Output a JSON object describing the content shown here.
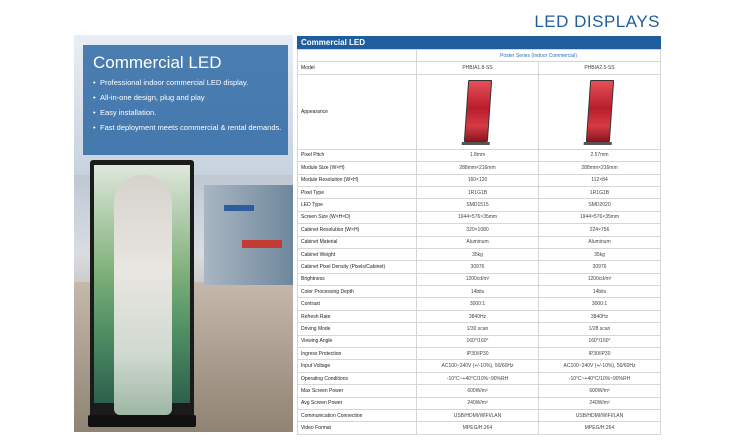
{
  "page_title": "LED DISPLAYS",
  "hero": {
    "title": "Commercial LED",
    "bullets": [
      "Professional indoor commercial LED display.",
      "All-in-one design, plug and play",
      "Easy installation.",
      "Fast deployment meets commercial & rental demands."
    ]
  },
  "table": {
    "header": "Commercial LED",
    "series": "Poster Series (Indoor Commercial)",
    "models": [
      "PHBIA1.8-SS",
      "PHBIA2.5-SS"
    ],
    "rows": [
      {
        "label": "Model",
        "values": [
          "PHBIA1.8-SS",
          "PHBIA2.5-SS"
        ]
      },
      {
        "label": "Appearance",
        "values": [
          "",
          ""
        ]
      },
      {
        "label": "Pixel Pitch",
        "values": [
          "1.8mm",
          "2.57mm"
        ]
      },
      {
        "label": "Module Size (W×H)",
        "values": [
          "288mm×216mm",
          "288mm×216mm"
        ]
      },
      {
        "label": "Module Resolution (W×H)",
        "values": [
          "160×120",
          "112×84"
        ]
      },
      {
        "label": "Pixel Type",
        "values": [
          "1R1G1B",
          "1R1G1B"
        ]
      },
      {
        "label": "LED Type",
        "values": [
          "SMD1515",
          "SMD2020"
        ]
      },
      {
        "label": "Screen Size (W×H×D)",
        "values": [
          "1944×576×35mm",
          "1944×576×35mm"
        ]
      },
      {
        "label": "Cabinet Resolution (W×H)",
        "values": [
          "320×1080",
          "224×756"
        ]
      },
      {
        "label": "Cabinet Material",
        "values": [
          "Aluminum",
          "Aluminum"
        ]
      },
      {
        "label": "Cabinet Weight",
        "values": [
          "35kg",
          "35kg"
        ]
      },
      {
        "label": "Cabinet Pixel Density (Pixels/Cabinet)",
        "values": [
          "30976",
          "30976"
        ]
      },
      {
        "label": "Brightness",
        "values": [
          "1200cd/m²",
          "1200cd/m²"
        ]
      },
      {
        "label": "Color Processing Depth",
        "values": [
          "14bits",
          "14bits"
        ]
      },
      {
        "label": "Contrast",
        "values": [
          "3000:1",
          "3000:1"
        ]
      },
      {
        "label": "Refresh Rate",
        "values": [
          "3840Hz",
          "3840Hz"
        ]
      },
      {
        "label": "Driving Mode",
        "values": [
          "1/30 scan",
          "1/28 scan"
        ]
      },
      {
        "label": "Viewing Angle",
        "values": [
          "160°/160°",
          "160°/160°"
        ]
      },
      {
        "label": "Ingress Protection",
        "values": [
          "IP30/IP30",
          "IP30/IP30"
        ]
      },
      {
        "label": "Input Voltage",
        "values": [
          "AC100~240V (+/-10%), 50/60Hz",
          "AC100~240V (+/-10%), 50/60Hz"
        ]
      },
      {
        "label": "Operating Conditions",
        "values": [
          "-10°C~+40°C/10%~90%RH",
          "-10°C~+40°C/10%~90%RH"
        ]
      },
      {
        "label": "Max Screen Power",
        "values": [
          "600W/m²",
          "600W/m²"
        ]
      },
      {
        "label": "Avg Screen Power",
        "values": [
          "240W/m²",
          "240W/m²"
        ]
      },
      {
        "label": "Communication Connection",
        "values": [
          "USB/HDMI/WIFI/LAN",
          "USB/HDMI/WIFI/LAN"
        ]
      },
      {
        "label": "Video Format",
        "values": [
          "MPEG/H.264",
          "MPEG/H.264"
        ]
      }
    ]
  }
}
